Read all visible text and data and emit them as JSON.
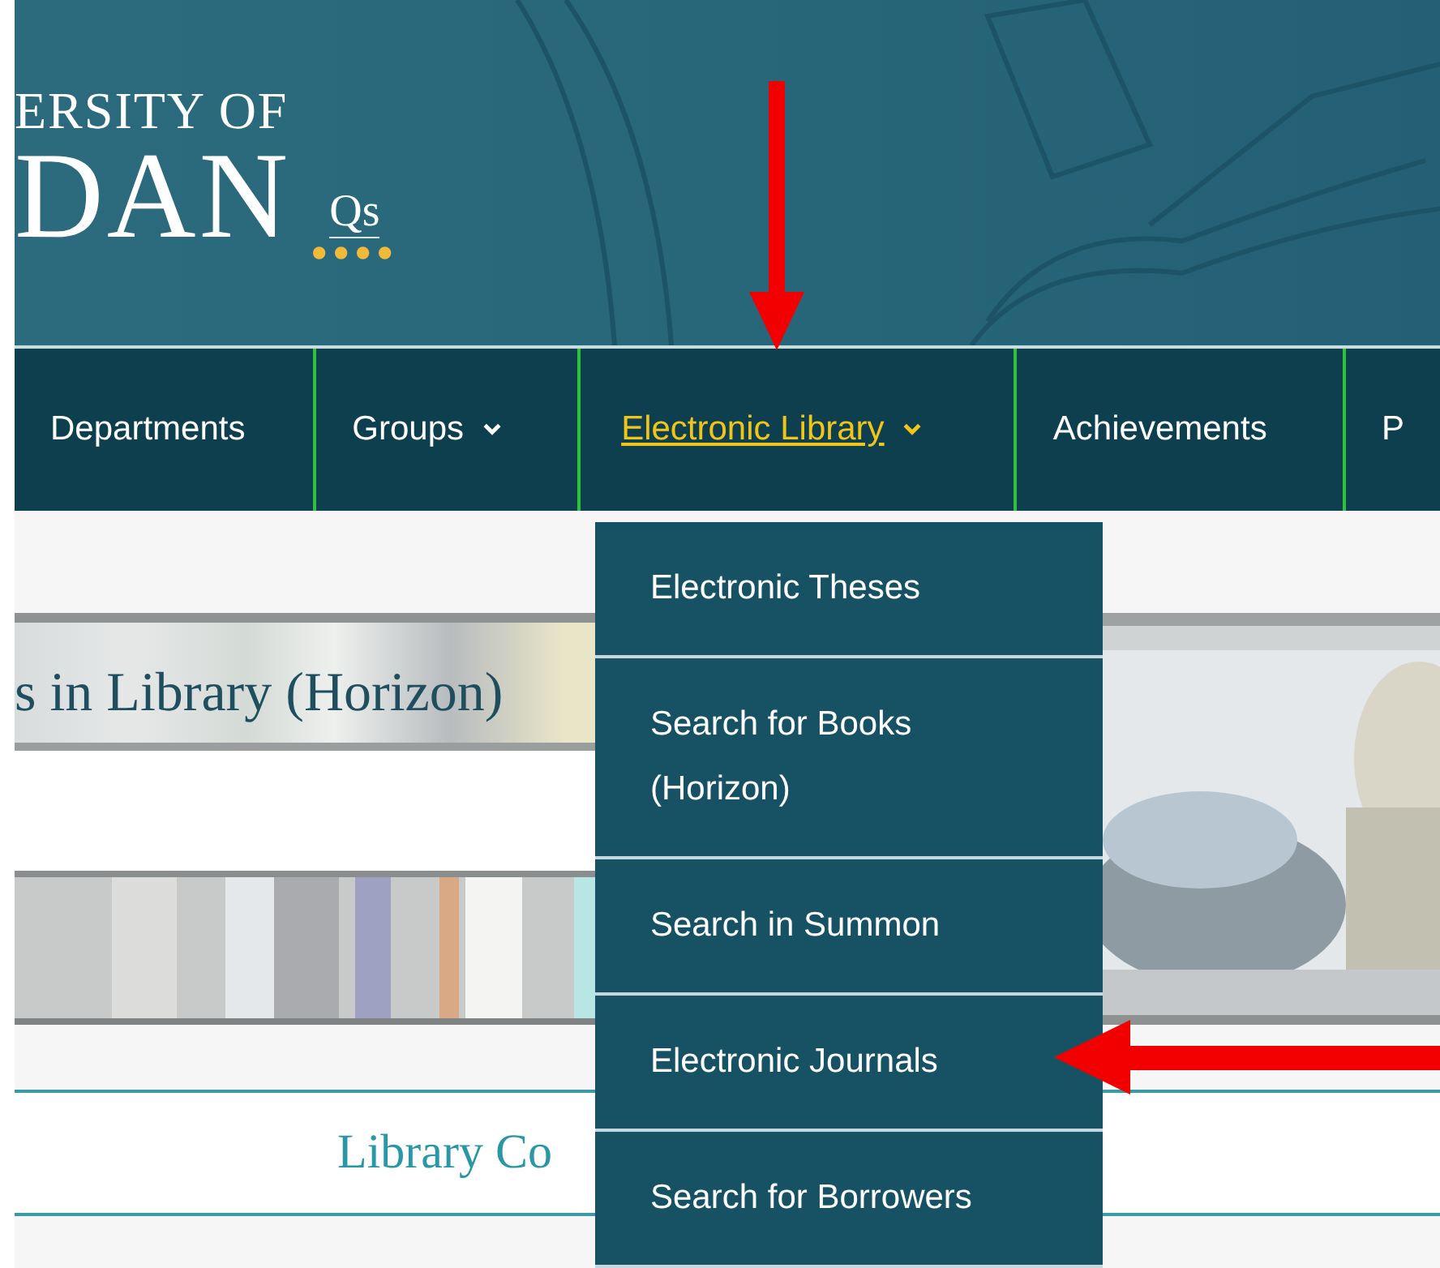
{
  "header": {
    "logo_line_1": "ERSITY OF",
    "logo_line_2": "DAN",
    "logo_badge": "Qs"
  },
  "nav": [
    {
      "label": "Departments",
      "selected": false,
      "dropdown": false
    },
    {
      "label": "Groups",
      "selected": false,
      "dropdown": true
    },
    {
      "label": "Electronic Library",
      "selected": true,
      "dropdown": true
    },
    {
      "label": "Achievements",
      "selected": false,
      "dropdown": false
    },
    {
      "label": "P",
      "selected": false,
      "dropdown": false
    }
  ],
  "dropdown": [
    {
      "label": "Electronic Theses"
    },
    {
      "label": "Search for Books (Horizon)"
    },
    {
      "label": "Search in Summon"
    },
    {
      "label": "Electronic Journals"
    },
    {
      "label": "Search for Borrowers"
    }
  ],
  "banner_heading": "s in Library (Horizon)",
  "section_heading": "Library Co"
}
